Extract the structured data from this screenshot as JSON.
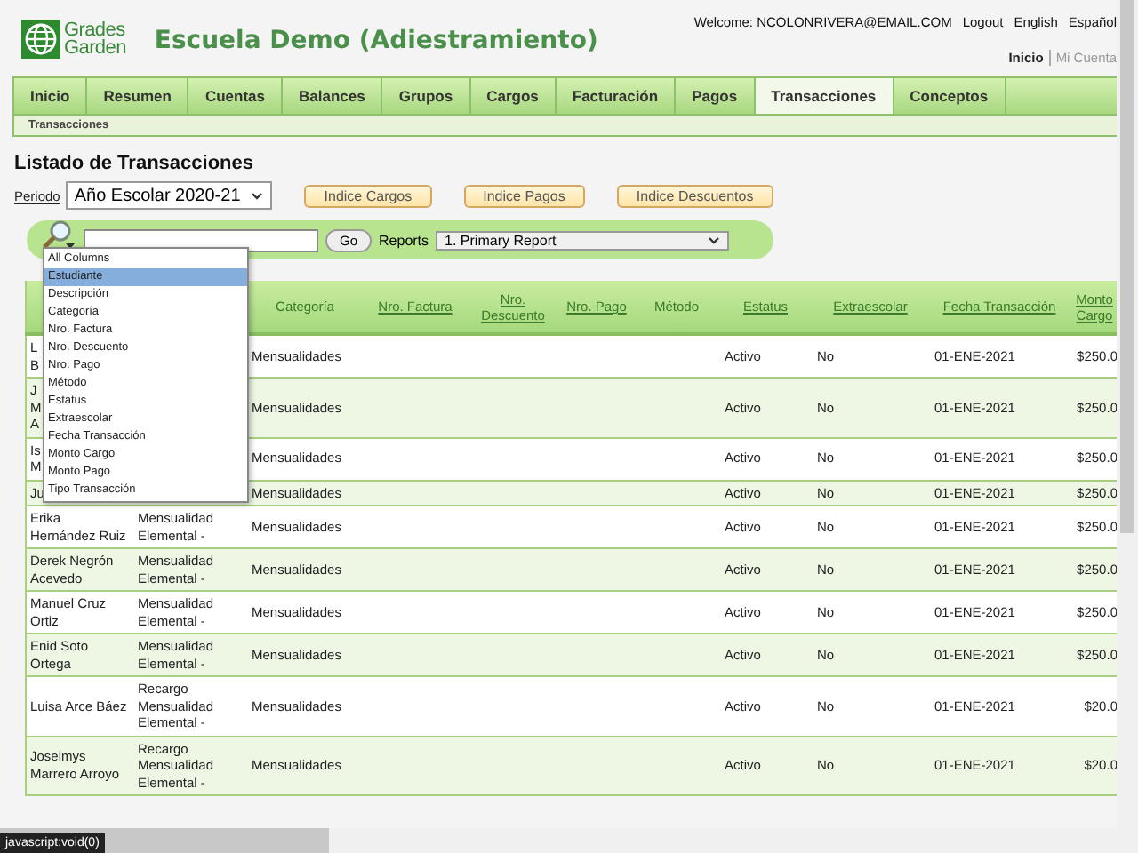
{
  "header": {
    "logo_text": [
      "Grades",
      "Garden"
    ],
    "school_title": "Escuela Demo (Adiestramiento)",
    "welcome": "Welcome: NCOLONRIVERA@EMAIL.COM",
    "links": [
      "Logout",
      "English",
      "Español"
    ],
    "account_links": [
      {
        "label": "Inicio",
        "selected": true
      },
      {
        "label": "Mi Cuenta",
        "selected": false
      }
    ]
  },
  "nav": {
    "tabs": [
      {
        "label": "Inicio",
        "selected": false
      },
      {
        "label": "Resumen",
        "selected": false
      },
      {
        "label": "Cuentas",
        "selected": false
      },
      {
        "label": "Balances",
        "selected": false
      },
      {
        "label": "Grupos",
        "selected": false
      },
      {
        "label": "Cargos",
        "selected": false
      },
      {
        "label": "Facturación",
        "selected": false
      },
      {
        "label": "Pagos",
        "selected": false
      },
      {
        "label": "Transacciones",
        "selected": true
      },
      {
        "label": "Conceptos",
        "selected": false
      }
    ],
    "subtabs": [
      "Transacciones"
    ]
  },
  "page_title": "Listado de Transacciones",
  "periodo": {
    "label": "Periodo",
    "value": "Año Escolar 2020-21"
  },
  "index_buttons": [
    "Indice Cargos",
    "Indice Pagos",
    "Indice Descuentos"
  ],
  "search": {
    "go_label": "Go",
    "reports_label": "Reports",
    "reports_value": "1. Primary Report"
  },
  "column_menu": {
    "items": [
      {
        "label": "All Columns",
        "selected": false
      },
      {
        "label": "Estudiante",
        "selected": true
      },
      {
        "label": "Descripción",
        "selected": false
      },
      {
        "label": "Categoría",
        "selected": false
      },
      {
        "label": "Nro. Factura",
        "selected": false
      },
      {
        "label": "Nro. Descuento",
        "selected": false
      },
      {
        "label": "Nro. Pago",
        "selected": false
      },
      {
        "label": "Método",
        "selected": false
      },
      {
        "label": "Estatus",
        "selected": false
      },
      {
        "label": "Extraescolar",
        "selected": false
      },
      {
        "label": "Fecha Transacción",
        "selected": false
      },
      {
        "label": "Monto Cargo",
        "selected": false
      },
      {
        "label": "Monto Pago",
        "selected": false
      },
      {
        "label": "Tipo Transacción",
        "selected": false
      }
    ]
  },
  "table": {
    "columns": [
      {
        "label": "Categoría",
        "sortable": false
      },
      {
        "label": "Nro. Factura",
        "sortable": true
      },
      {
        "label": "Nro. Descuento",
        "sortable": true
      },
      {
        "label": "Nro. Pago",
        "sortable": true
      },
      {
        "label": "Método",
        "sortable": false
      },
      {
        "label": "Estatus",
        "sortable": true
      },
      {
        "label": "Extraescolar",
        "sortable": true
      },
      {
        "label": "Fecha Transacción",
        "sortable": true
      },
      {
        "label": "Monto Cargo",
        "sortable": true
      }
    ],
    "rows": [
      {
        "student": "L\nB",
        "category": "Mensualidades",
        "status": "Activo",
        "extracurricular": "No",
        "date": "01-ENE-2021",
        "amount": "$250.0"
      },
      {
        "student": "J\nM\nA",
        "category": "Mensualidades",
        "status": "Activo",
        "extracurricular": "No",
        "date": "01-ENE-2021",
        "amount": "$250.0"
      },
      {
        "student": "Is\nM",
        "category": "Mensualidades",
        "status": "Activo",
        "extracurricular": "No",
        "date": "01-ENE-2021",
        "amount": "$250.0"
      },
      {
        "student": "Ju",
        "category": "Mensualidades",
        "status": "Activo",
        "extracurricular": "No",
        "date": "01-ENE-2021",
        "amount": "$250.0"
      },
      {
        "student": "Erika Hernández Ruiz",
        "description": "Mensualidad Elemental -",
        "category": "Mensualidades",
        "status": "Activo",
        "extracurricular": "No",
        "date": "01-ENE-2021",
        "amount": "$250.0"
      },
      {
        "student": "Derek Negrón Acevedo",
        "description": "Mensualidad Elemental -",
        "category": "Mensualidades",
        "status": "Activo",
        "extracurricular": "No",
        "date": "01-ENE-2021",
        "amount": "$250.0"
      },
      {
        "student": "Manuel Cruz Ortiz",
        "description": "Mensualidad Elemental -",
        "category": "Mensualidades",
        "status": "Activo",
        "extracurricular": "No",
        "date": "01-ENE-2021",
        "amount": "$250.0"
      },
      {
        "student": "Enid Soto Ortega",
        "description": "Mensualidad Elemental -",
        "category": "Mensualidades",
        "status": "Activo",
        "extracurricular": "No",
        "date": "01-ENE-2021",
        "amount": "$250.0"
      },
      {
        "student": "Luisa Arce Báez",
        "description": "Recargo Mensualidad Elemental -",
        "category": "Mensualidades",
        "status": "Activo",
        "extracurricular": "No",
        "date": "01-ENE-2021",
        "amount": "$20.0"
      },
      {
        "student": "Joseimys Marrero Arroyo",
        "description": "Recargo Mensualidad Elemental -",
        "category": "Mensualidades",
        "status": "Activo",
        "extracurricular": "No",
        "date": "01-ENE-2021",
        "amount": "$20.0"
      }
    ]
  },
  "status_tooltip": "javascript:void(0)"
}
